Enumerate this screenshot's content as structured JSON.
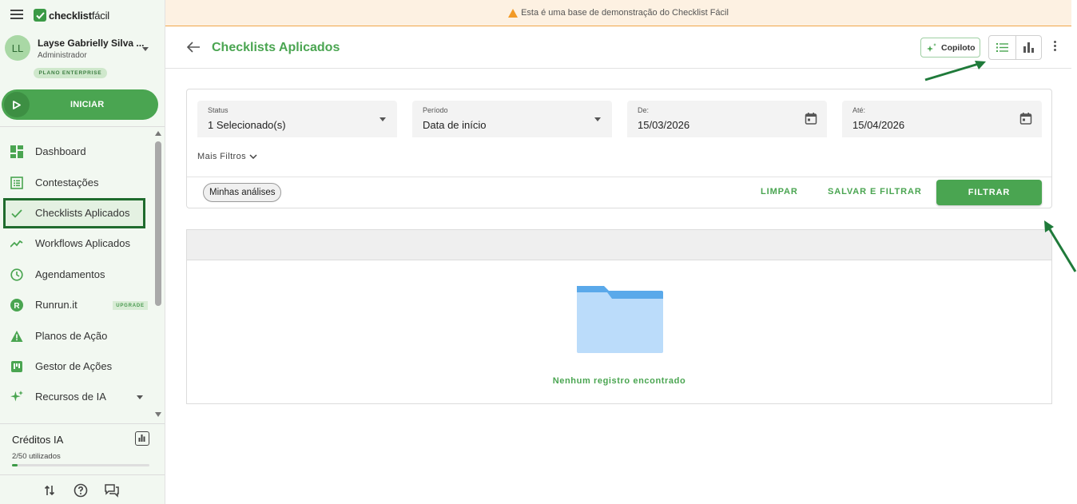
{
  "brand": {
    "name_bold": "checklist",
    "name_light": "fácil"
  },
  "user": {
    "initials": "LL",
    "name": "Layse Gabrielly Silva ...",
    "role": "Administrador",
    "plan": "PLANO ENTERPRISE"
  },
  "start": {
    "label": "INICIAR"
  },
  "nav": {
    "items": [
      {
        "label": "Dashboard"
      },
      {
        "label": "Contestações"
      },
      {
        "label": "Checklists Aplicados"
      },
      {
        "label": "Workflows Aplicados"
      },
      {
        "label": "Agendamentos"
      },
      {
        "label": "Runrun.it",
        "badge": "UPGRADE"
      },
      {
        "label": "Planos de Ação"
      },
      {
        "label": "Gestor de Ações"
      },
      {
        "label": "Recursos de IA"
      }
    ]
  },
  "credits": {
    "title": "Créditos IA",
    "used_text": "2/50 utilizados",
    "used": 2,
    "total": 50
  },
  "banner": {
    "text": "Esta é uma base de demonstração do Checklist Fácil"
  },
  "header": {
    "title": "Checklists Aplicados",
    "copilot_label": "Copiloto"
  },
  "filters": {
    "status": {
      "label": "Status",
      "value": "1 Selecionado(s)"
    },
    "period": {
      "label": "Período",
      "value": "Data de início"
    },
    "from": {
      "label": "De:",
      "value": "15/03/2026"
    },
    "to": {
      "label": "Até:",
      "value": "15/04/2026"
    },
    "more_filters": "Mais Filtros",
    "chip": "Minhas análises",
    "clear": "LIMPAR",
    "save_filter": "SALVAR E FILTRAR",
    "filter": "FILTRAR"
  },
  "results": {
    "empty_message": "Nenhum registro encontrado"
  },
  "colors": {
    "accent": "#4aa551",
    "active_border": "#1f6b2d",
    "annotation": "#1f7a3a",
    "warning": "#f29a26"
  }
}
